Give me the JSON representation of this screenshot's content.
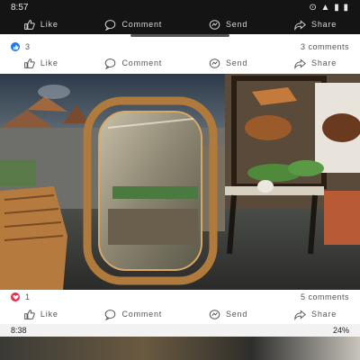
{
  "status_top": {
    "time": "8:57",
    "icons": "⊙ ▲ ▮ ▮"
  },
  "post_top": {
    "actions": [
      "Like",
      "Comment",
      "Send",
      "Share"
    ]
  },
  "post_top_reactions": {
    "count": "3",
    "comments": "3 comments"
  },
  "post_main": {
    "actions": [
      "Like",
      "Comment",
      "Send",
      "Share"
    ],
    "reactions": {
      "count": "1",
      "comments": "5 comments"
    },
    "actions_bottom": [
      "Like",
      "Comment",
      "Send",
      "Share"
    ]
  },
  "status_bottom": {
    "time": "8:38",
    "battery": "24%"
  },
  "colors": {
    "like_blue": "#1877f2",
    "love_red": "#f02849",
    "dark": "#141414"
  },
  "icons": {
    "like": "thumbs-up-icon",
    "comment": "comment-bubble-icon",
    "send": "send-icon",
    "share": "share-arrow-icon"
  }
}
